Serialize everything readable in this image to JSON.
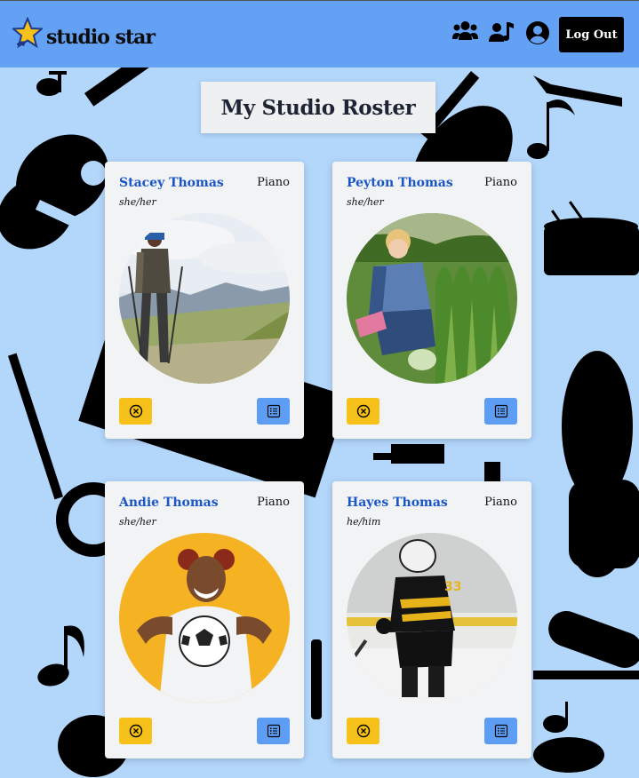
{
  "app": {
    "name": "studio star",
    "logout_label": "Log Out"
  },
  "header_icons": [
    "students-group-icon",
    "music-notes-user-icon",
    "account-circle-icon"
  ],
  "page": {
    "title": "My Studio Roster"
  },
  "students": [
    {
      "name": "Stacey Thomas",
      "instrument": "Piano",
      "pronouns": "she/her",
      "photo": "hiker-photo"
    },
    {
      "name": "Peyton Thomas",
      "instrument": "Piano",
      "pronouns": "she/her",
      "photo": "gardener-photo"
    },
    {
      "name": "Andie Thomas",
      "instrument": "Piano",
      "pronouns": "she/her",
      "photo": "soccer-girl-photo"
    },
    {
      "name": "Hayes Thomas",
      "instrument": "Piano",
      "pronouns": "he/him",
      "photo": "hockey-player-photo"
    }
  ],
  "colors": {
    "header": "#62a1f4",
    "background": "#b3d6fb",
    "accent_name": "#1b56c7",
    "remove_button": "#f6c21a",
    "details_button": "#5d9ef4"
  }
}
